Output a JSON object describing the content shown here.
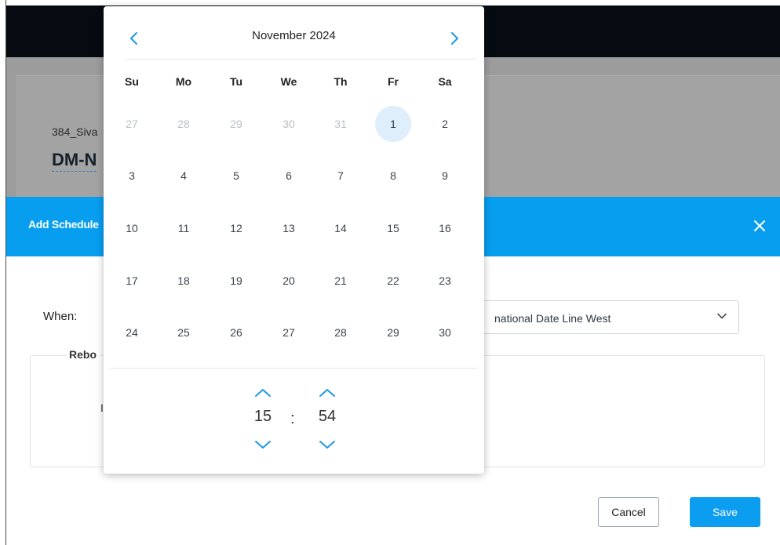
{
  "background": {
    "device_code": "384_Siva",
    "device_name": "DM-N"
  },
  "modal": {
    "title": "Add Schedule",
    "close_icon": "×",
    "when_label": "When:",
    "timezone_value": "national Date Line West",
    "section_legend": "Rebo",
    "inner_fragment": "I",
    "cancel_label": "Cancel",
    "save_label": "Save"
  },
  "picker": {
    "month_label": "November  2024",
    "prev_icon": "chevron-left-icon",
    "next_icon": "chevron-right-icon",
    "weekdays": [
      "Su",
      "Mo",
      "Tu",
      "We",
      "Th",
      "Fr",
      "Sa"
    ],
    "weeks": [
      [
        {
          "d": "27",
          "muted": true
        },
        {
          "d": "28",
          "muted": true
        },
        {
          "d": "29",
          "muted": true
        },
        {
          "d": "30",
          "muted": true
        },
        {
          "d": "31",
          "muted": true
        },
        {
          "d": "1",
          "selected": true
        },
        {
          "d": "2"
        }
      ],
      [
        {
          "d": "3"
        },
        {
          "d": "4"
        },
        {
          "d": "5"
        },
        {
          "d": "6"
        },
        {
          "d": "7"
        },
        {
          "d": "8"
        },
        {
          "d": "9"
        }
      ],
      [
        {
          "d": "10"
        },
        {
          "d": "11"
        },
        {
          "d": "12"
        },
        {
          "d": "13"
        },
        {
          "d": "14"
        },
        {
          "d": "15"
        },
        {
          "d": "16"
        }
      ],
      [
        {
          "d": "17"
        },
        {
          "d": "18"
        },
        {
          "d": "19"
        },
        {
          "d": "20"
        },
        {
          "d": "21"
        },
        {
          "d": "22"
        },
        {
          "d": "23"
        }
      ],
      [
        {
          "d": "24"
        },
        {
          "d": "25"
        },
        {
          "d": "26"
        },
        {
          "d": "27"
        },
        {
          "d": "28"
        },
        {
          "d": "29"
        },
        {
          "d": "30"
        }
      ]
    ],
    "time": {
      "hour": "15",
      "separator": ":",
      "minute": "54"
    }
  },
  "colors": {
    "accent": "#079ef0",
    "selected_day_bg": "#deeefa",
    "nav_chevron": "#1a9ae6",
    "topbar": "#050b10",
    "overlay_gray": "#9c9c9c"
  }
}
